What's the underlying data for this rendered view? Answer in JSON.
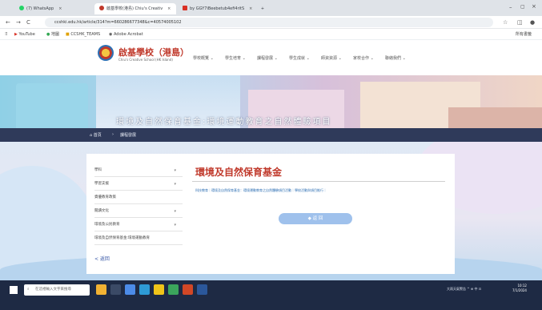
{
  "browser": {
    "tabs": [
      {
        "label": "(7) WhatsApp",
        "active": false
      },
      {
        "label": "啟基學校(港島) Chiu's Creativ",
        "active": true
      },
      {
        "label": "by GGY7iBeebetub4efi4ritS",
        "active": false
      }
    ],
    "new_tab": "+",
    "back": "←",
    "forward": "→",
    "reload": "C",
    "url": "ccshki.edu.hk/article/314?m=660286677348&c=40574005102",
    "bookmarks": [
      "YouTube",
      "地圖",
      "CCSHK_TEAMS",
      "Adobe Acrobat"
    ],
    "all_bookmarks": "所有書籤"
  },
  "site": {
    "name": "啟基學校（港島）",
    "subtitle": "Chiu's Creative School (HK Island)",
    "nav": [
      "學校概覽 ⌄",
      "學生培育 ⌄",
      "課程發展 ⌄",
      "學生成就 ⌄",
      "師資資源 ⌄",
      "家校合作 ⌄",
      "聯絡我們 ⌄"
    ]
  },
  "banner": {
    "title": "環境及自然保育基金:環境運動教育之自然體驗項目"
  },
  "breadcrumb": {
    "home": "首頁",
    "sep": "›",
    "current": "課程發展"
  },
  "sidebar": {
    "items": [
      {
        "label": "學科",
        "arrow": "▾"
      },
      {
        "label": "學習支援",
        "arrow": "▾"
      },
      {
        "label": "資優教育政策",
        "arrow": ""
      },
      {
        "label": "閱讀文化",
        "arrow": "▾"
      },
      {
        "label": "環境及公民教育",
        "arrow": "▾"
      },
      {
        "label": "環境及自然保育基金:環境運動教育",
        "arrow": ""
      }
    ],
    "back_label": "< 返回"
  },
  "article": {
    "title": "環境及自然保育基金",
    "link": "科技教育｜環境及自然保育基金：環境運動教育之自然體驗項目活動｜學校活動與項目推行｜"
  },
  "actions": {
    "back_button": "◆ 返 回"
  },
  "taskbar": {
    "search_placeholder": "在這裡輸入文字來搜尋",
    "tray": "大雨天氣警告 ^ ⊕ 中 ⊡",
    "time": "10:12",
    "date": "7/1/2024"
  },
  "colors": {
    "brand_red": "#c0392b",
    "brand_blue": "#2e6fb3",
    "crumb_bar": "#2f3a5a",
    "taskbar": "#1e2a44"
  }
}
